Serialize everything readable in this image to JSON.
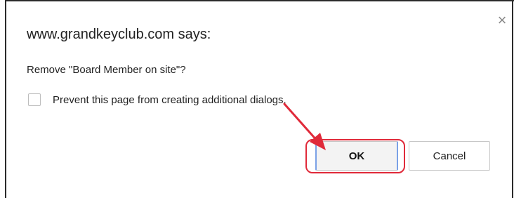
{
  "dialog": {
    "title": "www.grandkeyclub.com says:",
    "message": "Remove \"Board Member on site\"?",
    "checkbox_label": "Prevent this page from creating additional dialogs.",
    "checkbox_checked": false,
    "close_symbol": "×",
    "ok_label": "OK",
    "cancel_label": "Cancel"
  },
  "annotation": {
    "color": "#e02a3a",
    "arrow_icon": "red-arrow-pointing-to-ok",
    "highlight_icon": "red-rounded-rectangle-around-ok"
  }
}
